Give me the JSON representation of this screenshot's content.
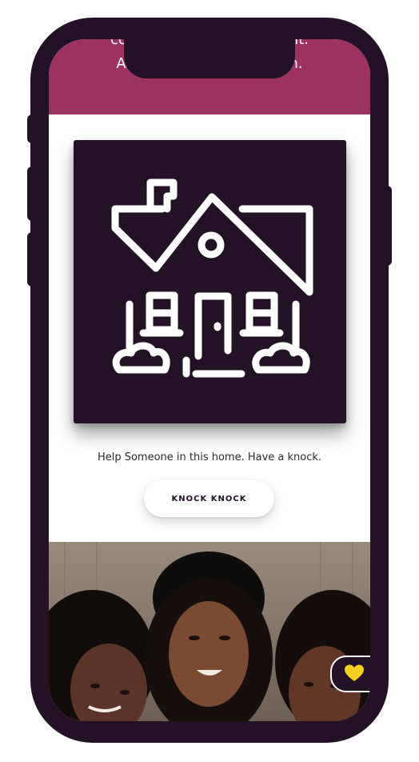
{
  "banner": {
    "line1": "consectetur adipisicing elit.",
    "line2": "Accusantium, quibusdam."
  },
  "card": {
    "icon": "house-icon",
    "caption": "Help Someone in this home. Have a knock.",
    "button_label": "KNOCK KNOCK"
  },
  "photo": {
    "subject": "three-women-photo"
  },
  "floating": {
    "icon": "heart-icon"
  },
  "colors": {
    "frame": "#231226",
    "banner": "#9b3260",
    "heart": "#f5d020",
    "background": "#ffffff"
  }
}
